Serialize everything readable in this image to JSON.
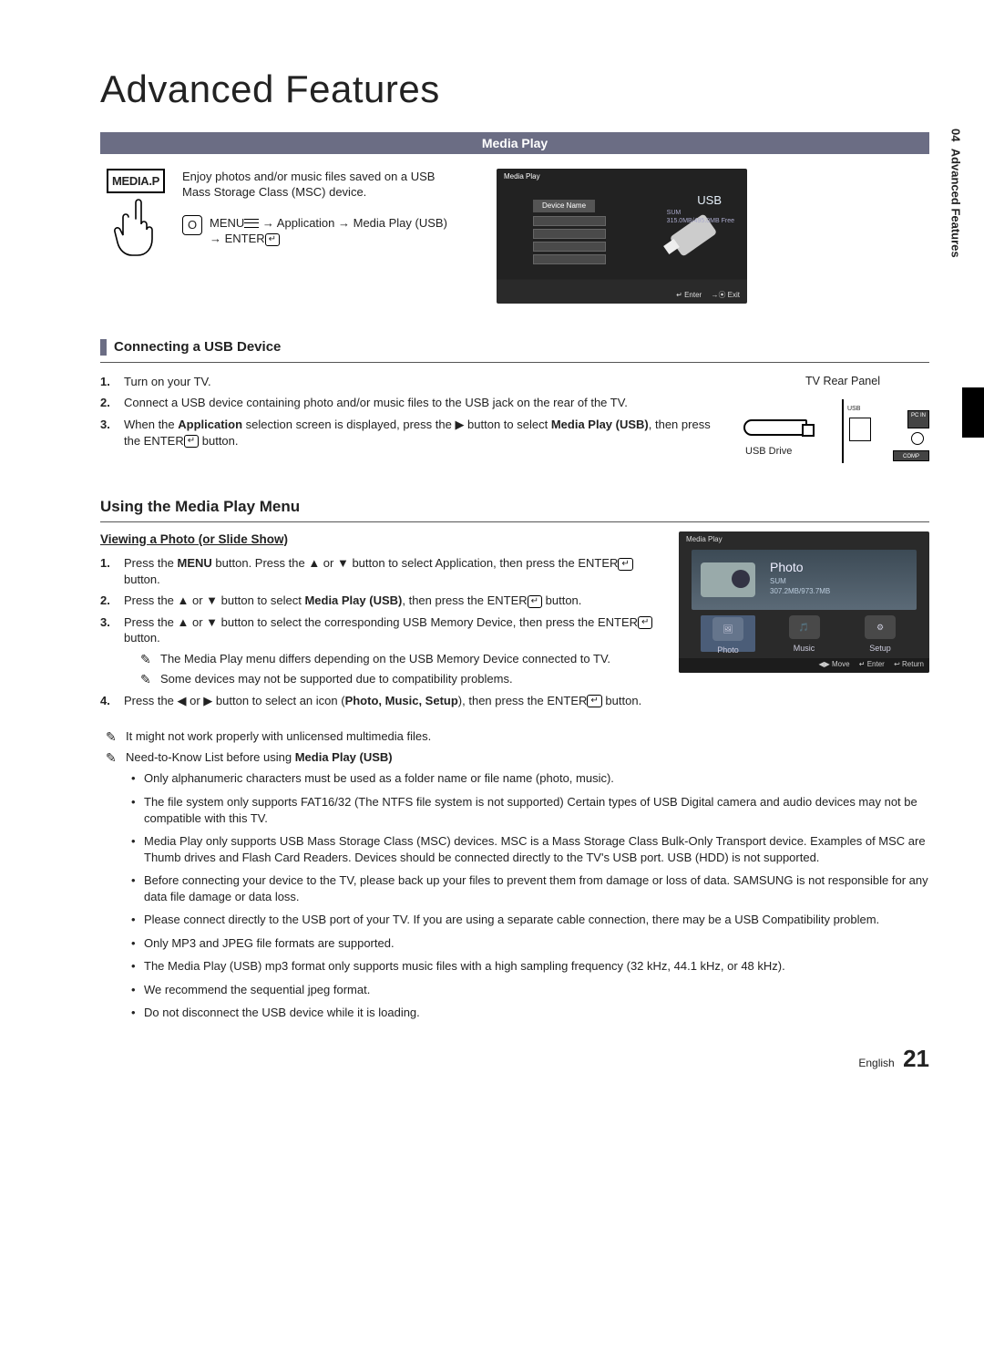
{
  "sideTab": {
    "chapter": "04",
    "section": "Advanced Features"
  },
  "title": "Advanced Features",
  "band": "Media Play",
  "intro": {
    "iconLabel": "MEDIA.P",
    "desc": "Enjoy photos and/or music files saved on a USB Mass Storage Class (MSC) device.",
    "path_prefix": "MENU",
    "path_mid": " → Application → Media Play (USB) → ENTER",
    "path_enter": "↵"
  },
  "shot1": {
    "header": "Media Play",
    "deviceName": "Device Name",
    "usb": "USB",
    "sum": "SUM",
    "free": "315.0MB/495.0MB Free",
    "enter": "↵ Enter",
    "exit": "→⦿ Exit"
  },
  "sec1": {
    "heading": "Connecting a USB Device",
    "steps": [
      "Turn on your TV.",
      "Connect a USB device containing photo and/or music files to the USB jack on the rear of the TV.",
      "When the <b>Application</b> selection screen is displayed, press the ▶ button to select <b>Media Play (USB)</b>, then press the ENTER<span class=\"enter-icon\">↵</span> button."
    ],
    "rearLabel": "TV Rear Panel",
    "usbDrive": "USB Drive",
    "usbPort": "USB",
    "pcin": "PC IN",
    "comp": "COMP"
  },
  "sec2": {
    "heading": "Using the Media Play Menu",
    "subhead": "Viewing a Photo (or Slide Show)",
    "steps": [
      "Press the <b>MENU</b> button. Press the ▲ or ▼ button to select Application, then press the ENTER<span class=\"enter-icon\">↵</span> button.",
      "Press the ▲ or ▼ button to select <b>Media Play (USB)</b>, then press the ENTER<span class=\"enter-icon\">↵</span> button.",
      "Press the ▲ or ▼ button to select the corresponding USB Memory Device, then press the ENTER<span class=\"enter-icon\">↵</span> button.",
      "Press the ◀ or ▶ button to select an icon (<b>Photo, Music, Setup</b>), then press the ENTER<span class=\"enter-icon\">↵</span> button."
    ],
    "notes3": [
      "The Media Play menu differs depending on the USB Memory Device connected to TV.",
      "Some devices may not be supported due to compatibility problems."
    ]
  },
  "shot2": {
    "header": "Media Play",
    "title": "Photo",
    "sum": "SUM",
    "size": "307.2MB/973.7MB",
    "tiles": [
      "Photo",
      "Music",
      "Setup"
    ],
    "move": "◀▶ Move",
    "enter": "↵ Enter",
    "ret": "↩ Return"
  },
  "secondaryNotes": [
    "It might not work properly with unlicensed multimedia files.",
    "Need-to-Know List before using <b>Media Play (USB)</b>"
  ],
  "bullets": [
    "Only alphanumeric characters must be used as a folder name or file name (photo, music).",
    "The file system only supports FAT16/32 (The NTFS file system is not supported) Certain types of USB Digital camera and audio devices may not be compatible with this TV.",
    "Media Play only supports USB Mass Storage Class (MSC) devices. MSC is a Mass Storage Class Bulk-Only Transport device. Examples of MSC are Thumb drives and Flash Card Readers. Devices should be connected directly to the TV's USB port. USB (HDD) is not supported.",
    "Before connecting your device to the TV, please back up your files to prevent them from damage or loss of data. SAMSUNG is not responsible for any data file damage or data loss.",
    "Please connect directly to the USB port of your TV. If you are using a separate cable connection, there may be a USB Compatibility problem.",
    "Only MP3 and JPEG file formats are supported.",
    "The Media Play (USB) mp3 format only supports music files with a high sampling frequency (32 kHz, 44.1 kHz, or 48 kHz).",
    "We recommend the sequential jpeg format.",
    "Do not disconnect the USB device while it is loading."
  ],
  "footer": {
    "lang": "English",
    "page": "21"
  }
}
